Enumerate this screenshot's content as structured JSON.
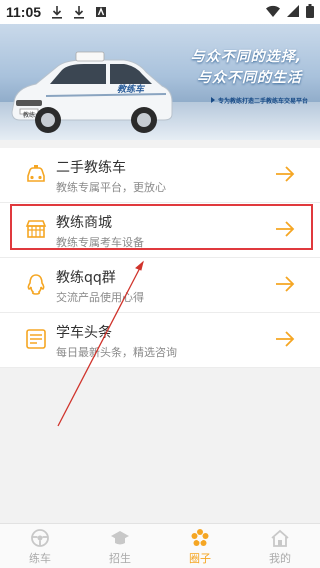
{
  "status_bar": {
    "time": "11:05"
  },
  "banner": {
    "slogan_line1": "与众不同的选择,",
    "slogan_line2": "与众不同的生活",
    "subtitle": "专为教练打造二手教练车交易平台",
    "car_door_label": "教练车",
    "plate_label": "教练"
  },
  "menu": {
    "items": [
      {
        "title": "二手教练车",
        "subtitle": "教练专属平台，更放心",
        "icon": "car-icon"
      },
      {
        "title": "教练商城",
        "subtitle": "教练专属考车设备",
        "icon": "shop-icon"
      },
      {
        "title": "教练qq群",
        "subtitle": "交流产品使用心得",
        "icon": "qq-icon"
      },
      {
        "title": "学车头条",
        "subtitle": "每日最新头条，精选咨询",
        "icon": "news-icon"
      }
    ]
  },
  "tabbar": {
    "tabs": [
      {
        "label": "练车",
        "active": false
      },
      {
        "label": "招生",
        "active": false
      },
      {
        "label": "圈子",
        "active": true
      },
      {
        "label": "我的",
        "active": false
      }
    ]
  },
  "colors": {
    "accent": "#f5a623",
    "highlight": "#e0393d"
  }
}
